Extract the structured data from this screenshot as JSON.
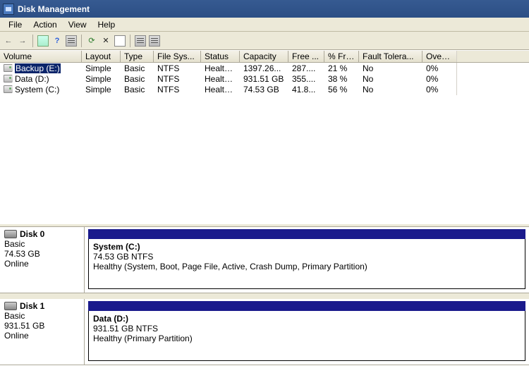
{
  "title": "Disk Management",
  "menu": {
    "file": "File",
    "action": "Action",
    "view": "View",
    "help": "Help"
  },
  "columns": {
    "volume": "Volume",
    "layout": "Layout",
    "type": "Type",
    "filesys": "File Sys...",
    "status": "Status",
    "capacity": "Capacity",
    "free": "Free ...",
    "pctfree": "% Free",
    "fault": "Fault Tolera...",
    "overhead": "Overh..."
  },
  "volumes": [
    {
      "name": "Backup (E:)",
      "layout": "Simple",
      "type": "Basic",
      "fs": "NTFS",
      "status": "Health...",
      "capacity": "1397.26...",
      "free": "287....",
      "pct": "21 %",
      "fault": "No",
      "ov": "0%",
      "selected": true
    },
    {
      "name": "Data (D:)",
      "layout": "Simple",
      "type": "Basic",
      "fs": "NTFS",
      "status": "Health...",
      "capacity": "931.51 GB",
      "free": "355....",
      "pct": "38 %",
      "fault": "No",
      "ov": "0%",
      "selected": false
    },
    {
      "name": "System (C:)",
      "layout": "Simple",
      "type": "Basic",
      "fs": "NTFS",
      "status": "Health...",
      "capacity": "74.53 GB",
      "free": "41.8...",
      "pct": "56 %",
      "fault": "No",
      "ov": "0%",
      "selected": false
    }
  ],
  "disks": [
    {
      "name": "Disk 0",
      "type": "Basic",
      "size": "74.53 GB",
      "status": "Online",
      "part": {
        "name": "System  (C:)",
        "line2": "74.53 GB NTFS",
        "line3": "Healthy (System, Boot, Page File, Active, Crash Dump, Primary Partition)"
      }
    },
    {
      "name": "Disk 1",
      "type": "Basic",
      "size": "931.51 GB",
      "status": "Online",
      "part": {
        "name": "Data  (D:)",
        "line2": "931.51 GB NTFS",
        "line3": "Healthy (Primary Partition)"
      }
    }
  ]
}
